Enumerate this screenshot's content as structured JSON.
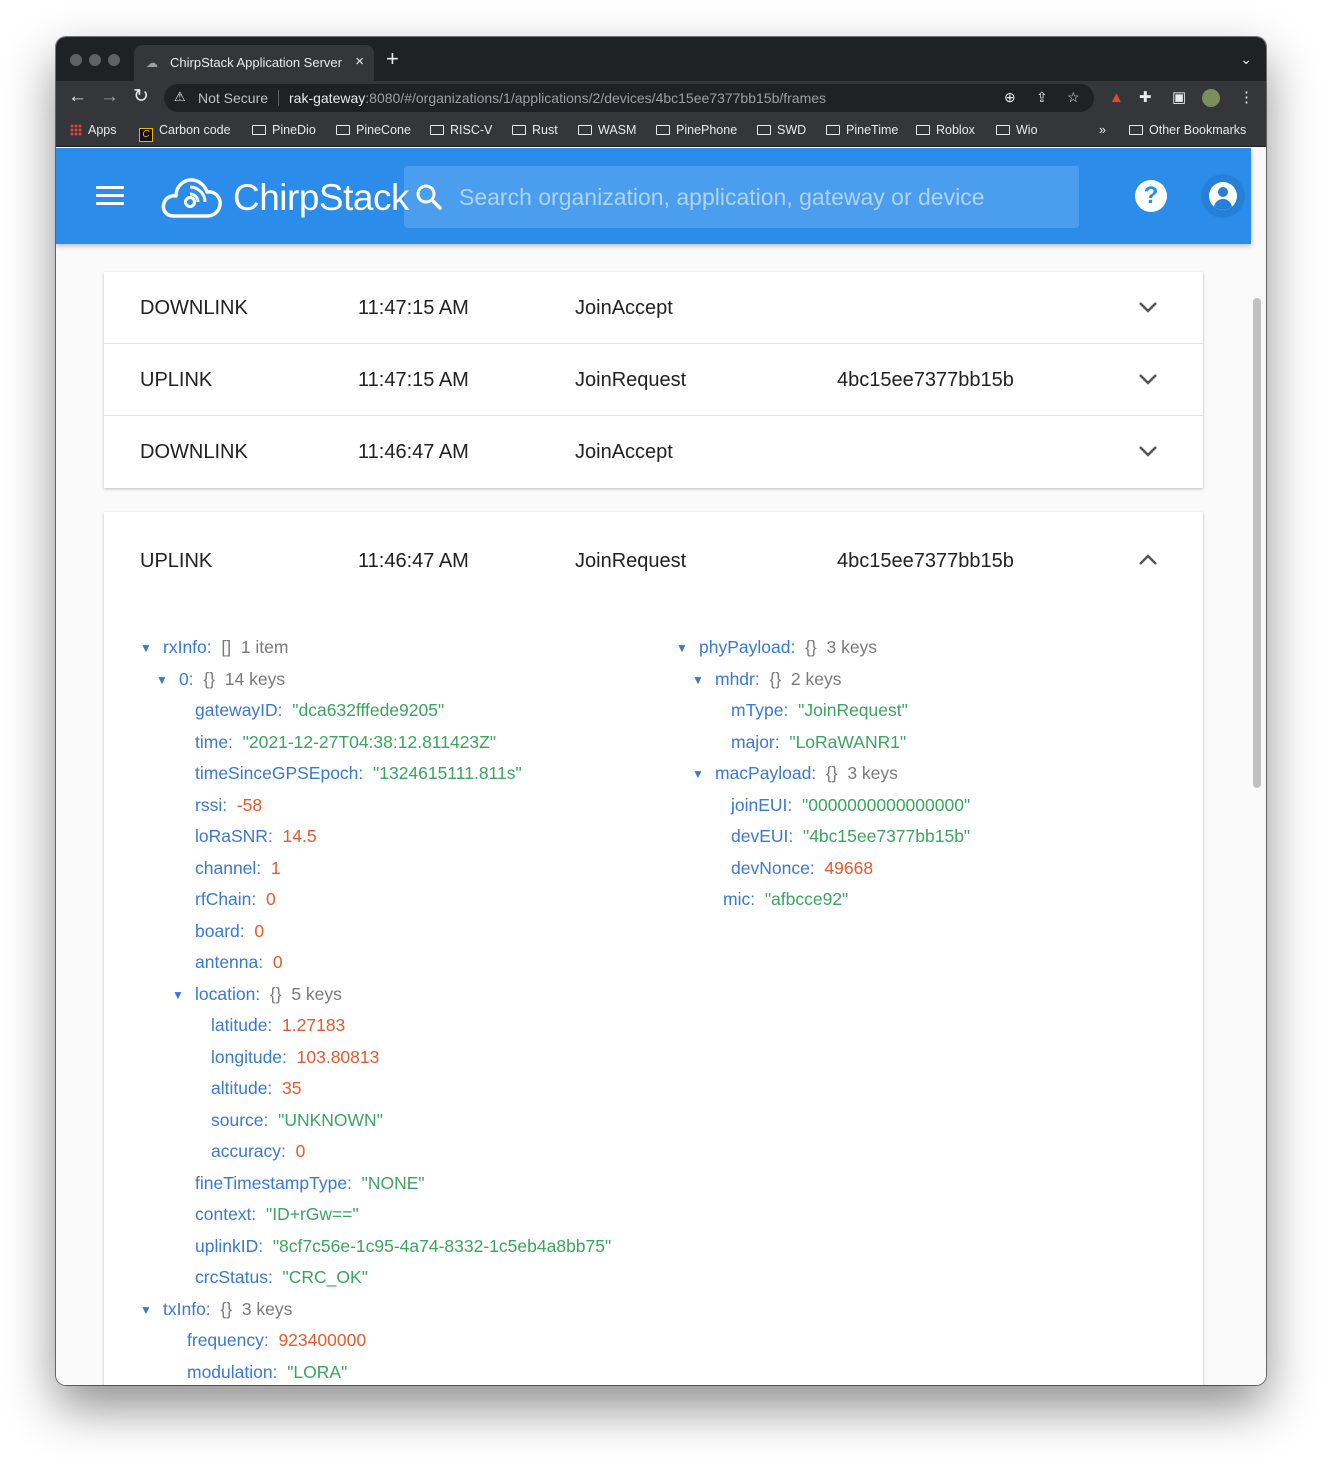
{
  "browser": {
    "tab_title": "ChirpStack Application Server",
    "tab_close": "×",
    "new_tab": "+",
    "security_label": "Not Secure",
    "url_host": "rak-gateway",
    "url_rest": ":8080/#/organizations/1/applications/2/devices/4bc15ee7377bb15b/frames",
    "bookmarks": [
      "Apps",
      "Carbon code",
      "PineDio",
      "PineCone",
      "RISC-V",
      "Rust",
      "WASM",
      "PinePhone",
      "SWD",
      "PineTime",
      "Roblox",
      "Wio"
    ],
    "bookmarks_overflow": "»",
    "other_bookmarks": "Other Bookmarks"
  },
  "app": {
    "brand": "ChirpStack",
    "search_placeholder": "Search organization, application, gateway or device",
    "help_label": "?"
  },
  "frames": [
    {
      "direction": "DOWNLINK",
      "time": "11:47:15 AM",
      "type": "JoinAccept",
      "dev_eui": "",
      "expanded": false
    },
    {
      "direction": "UPLINK",
      "time": "11:47:15 AM",
      "type": "JoinRequest",
      "dev_eui": "4bc15ee7377bb15b",
      "expanded": false
    },
    {
      "direction": "DOWNLINK",
      "time": "11:46:47 AM",
      "type": "JoinAccept",
      "dev_eui": "",
      "expanded": false
    },
    {
      "direction": "UPLINK",
      "time": "11:46:47 AM",
      "type": "JoinRequest",
      "dev_eui": "4bc15ee7377bb15b",
      "expanded": true
    }
  ],
  "json_left": [
    {
      "depth": 0,
      "toggle": true,
      "key": "rxInfo:",
      "meta": "[]  1 item"
    },
    {
      "depth": 1,
      "toggle": true,
      "key": "0:",
      "meta": "{}  14 keys"
    },
    {
      "depth": 2,
      "key": "gatewayID:",
      "value": "\"dca632fffede9205\"",
      "vtype": "s"
    },
    {
      "depth": 2,
      "key": "time:",
      "value": "\"2021-12-27T04:38:12.811423Z\"",
      "vtype": "s"
    },
    {
      "depth": 2,
      "key": "timeSinceGPSEpoch:",
      "value": "\"1324615111.811s\"",
      "vtype": "s"
    },
    {
      "depth": 2,
      "key": "rssi:",
      "value": "-58",
      "vtype": "n"
    },
    {
      "depth": 2,
      "key": "loRaSNR:",
      "value": "14.5",
      "vtype": "n"
    },
    {
      "depth": 2,
      "key": "channel:",
      "value": "1",
      "vtype": "n"
    },
    {
      "depth": 2,
      "key": "rfChain:",
      "value": "0",
      "vtype": "n"
    },
    {
      "depth": 2,
      "key": "board:",
      "value": "0",
      "vtype": "n"
    },
    {
      "depth": 2,
      "key": "antenna:",
      "value": "0",
      "vtype": "n"
    },
    {
      "depth": 2,
      "toggle": true,
      "key": "location:",
      "meta": "{}  5 keys"
    },
    {
      "depth": 3,
      "key": "latitude:",
      "value": "1.27183",
      "vtype": "n"
    },
    {
      "depth": 3,
      "key": "longitude:",
      "value": "103.80813",
      "vtype": "n"
    },
    {
      "depth": 3,
      "key": "altitude:",
      "value": "35",
      "vtype": "n"
    },
    {
      "depth": 3,
      "key": "source:",
      "value": "\"UNKNOWN\"",
      "vtype": "s"
    },
    {
      "depth": 3,
      "key": "accuracy:",
      "value": "0",
      "vtype": "n"
    },
    {
      "depth": 2,
      "key": "fineTimestampType:",
      "value": "\"NONE\"",
      "vtype": "s"
    },
    {
      "depth": 2,
      "key": "context:",
      "value": "\"ID+rGw==\"",
      "vtype": "s"
    },
    {
      "depth": 2,
      "key": "uplinkID:",
      "value": "\"8cf7c56e-1c95-4a74-8332-1c5eb4a8bb75\"",
      "vtype": "s"
    },
    {
      "depth": 2,
      "key": "crcStatus:",
      "value": "\"CRC_OK\"",
      "vtype": "s"
    },
    {
      "depth": 0,
      "toggle": true,
      "key": "txInfo:",
      "meta": "{}  3 keys"
    },
    {
      "depth": 1.5,
      "key": "frequency:",
      "value": "923400000",
      "vtype": "n"
    },
    {
      "depth": 1.5,
      "key": "modulation:",
      "value": "\"LORA\"",
      "vtype": "s"
    }
  ],
  "json_right": [
    {
      "depth": 0,
      "toggle": true,
      "key": "phyPayload:",
      "meta": "{}  3 keys"
    },
    {
      "depth": 1,
      "toggle": true,
      "key": "mhdr:",
      "meta": "{}  2 keys"
    },
    {
      "depth": 2,
      "key": "mType:",
      "value": "\"JoinRequest\"",
      "vtype": "s"
    },
    {
      "depth": 2,
      "key": "major:",
      "value": "\"LoRaWANR1\"",
      "vtype": "s"
    },
    {
      "depth": 1,
      "toggle": true,
      "key": "macPayload:",
      "meta": "{}  3 keys"
    },
    {
      "depth": 2,
      "key": "joinEUI:",
      "value": "\"0000000000000000\"",
      "vtype": "s"
    },
    {
      "depth": 2,
      "key": "devEUI:",
      "value": "\"4bc15ee7377bb15b\"",
      "vtype": "s"
    },
    {
      "depth": 2,
      "key": "devNonce:",
      "value": "49668",
      "vtype": "n"
    },
    {
      "depth": 1.5,
      "key": "mic:",
      "value": "\"afbcce92\"",
      "vtype": "s"
    }
  ]
}
